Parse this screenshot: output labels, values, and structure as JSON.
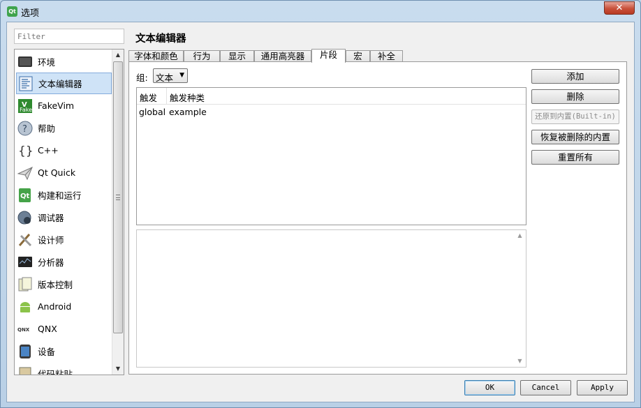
{
  "window": {
    "title": "选项",
    "app_icon": "qt-icon",
    "close_label": "✕"
  },
  "filter": {
    "placeholder": "Filter"
  },
  "categories": [
    {
      "label": "环境",
      "icon": "monitor-icon"
    },
    {
      "label": "文本编辑器",
      "icon": "text-editor-icon",
      "selected": true
    },
    {
      "label": "FakeVim",
      "icon": "fakevim-icon"
    },
    {
      "label": "帮助",
      "icon": "help-icon"
    },
    {
      "label": "C++",
      "icon": "braces-icon"
    },
    {
      "label": "Qt Quick",
      "icon": "paper-plane-icon"
    },
    {
      "label": "构建和运行",
      "icon": "build-run-icon"
    },
    {
      "label": "调试器",
      "icon": "debugger-icon"
    },
    {
      "label": "设计师",
      "icon": "designer-icon"
    },
    {
      "label": "分析器",
      "icon": "analyzer-icon"
    },
    {
      "label": "版本控制",
      "icon": "version-control-icon"
    },
    {
      "label": "Android",
      "icon": "android-icon"
    },
    {
      "label": "QNX",
      "icon": "qnx-icon"
    },
    {
      "label": "设备",
      "icon": "device-icon"
    },
    {
      "label": "代码粘贴",
      "icon": "code-paste-icon"
    }
  ],
  "page_title": "文本编辑器",
  "tabs": [
    {
      "label": "字体和颜色"
    },
    {
      "label": "行为"
    },
    {
      "label": "显示"
    },
    {
      "label": "通用高亮器"
    },
    {
      "label": "片段",
      "active": true
    },
    {
      "label": "宏"
    },
    {
      "label": "补全"
    }
  ],
  "snippets": {
    "group_label": "组:",
    "group_value": "文本",
    "columns": [
      "触发",
      "触发种类"
    ],
    "rows": [
      {
        "trigger": "global",
        "trigger_kind": "example"
      }
    ]
  },
  "side_buttons": {
    "add": "添加",
    "remove": "删除",
    "revert_builtin": "还原到内置(Built-in)",
    "restore_removed": "恢复被删除的内置",
    "reset_all": "重置所有"
  },
  "dialog_buttons": {
    "ok": "OK",
    "cancel": "Cancel",
    "apply": "Apply"
  }
}
